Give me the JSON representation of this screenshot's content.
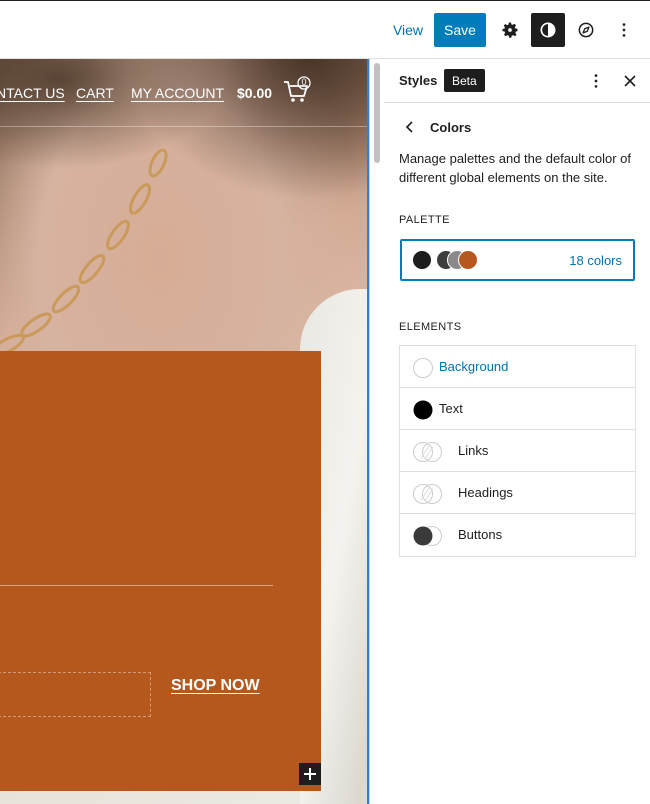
{
  "toolbar": {
    "view_label": "View",
    "save_label": "Save",
    "accent": "#007cba"
  },
  "canvas": {
    "nav": {
      "items": [
        "NTACT US",
        "CART",
        "MY ACCOUNT"
      ],
      "price": "$0.00",
      "cart_count": "0"
    },
    "promo": {
      "cta_label": "SHOP NOW",
      "background": "#b5581d"
    }
  },
  "sidebar": {
    "title": "Styles",
    "badge": "Beta",
    "section_title": "Colors",
    "description": "Manage palettes and the default color of different global elements on the site.",
    "palette": {
      "label": "PALETTE",
      "count_label": "18 colors",
      "swatches": [
        "#1e1e1e",
        "#3d3d3d",
        "#8a8a8a",
        "#b5581d"
      ]
    },
    "elements": {
      "label": "ELEMENTS",
      "items": [
        {
          "label": "Background",
          "icon": "empty-circle-icon"
        },
        {
          "label": "Text",
          "icon": "black-circle-icon"
        },
        {
          "label": "Links",
          "icon": "double-outline-circle-icon"
        },
        {
          "label": "Headings",
          "icon": "double-outline-circle-icon"
        },
        {
          "label": "Buttons",
          "icon": "dark-light-circle-icon"
        }
      ]
    }
  }
}
